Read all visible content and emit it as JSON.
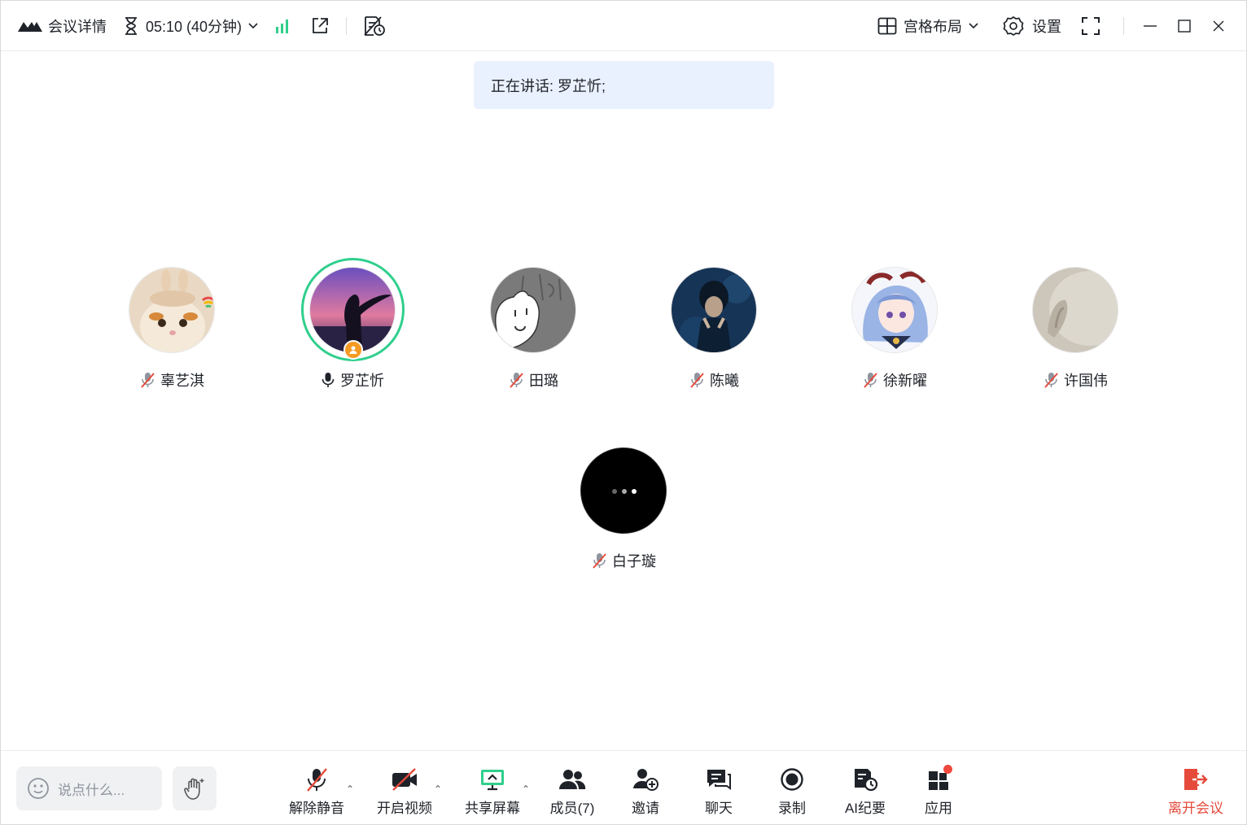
{
  "topbar": {
    "meeting_details": "会议详情",
    "timer": "05:10 (40分钟)",
    "layout_label": "宫格布局",
    "settings_label": "设置"
  },
  "banner": {
    "speaking_text": "正在讲话: 罗芷忻;"
  },
  "participants": [
    {
      "name": "辜艺淇",
      "mic": "muted"
    },
    {
      "name": "罗芷忻",
      "mic": "on",
      "speaking": true,
      "host": true
    },
    {
      "name": "田璐",
      "mic": "muted"
    },
    {
      "name": "陈曦",
      "mic": "muted"
    },
    {
      "name": "徐新曜",
      "mic": "muted"
    },
    {
      "name": "许国伟",
      "mic": "muted"
    },
    {
      "name": "白子璇",
      "mic": "muted"
    }
  ],
  "bottombar": {
    "chat_placeholder": "说点什么...",
    "unmute": "解除静音",
    "start_video": "开启视频",
    "share_screen": "共享屏幕",
    "members": "成员(7)",
    "invite": "邀请",
    "chat": "聊天",
    "record": "录制",
    "ai_summary": "AI纪要",
    "apps": "应用",
    "leave": "离开会议"
  },
  "colors": {
    "accent_green": "#2fcf8c",
    "leave_red": "#e54a3b",
    "banner_bg": "#eaf1fe",
    "host_badge": "#f59a23"
  }
}
